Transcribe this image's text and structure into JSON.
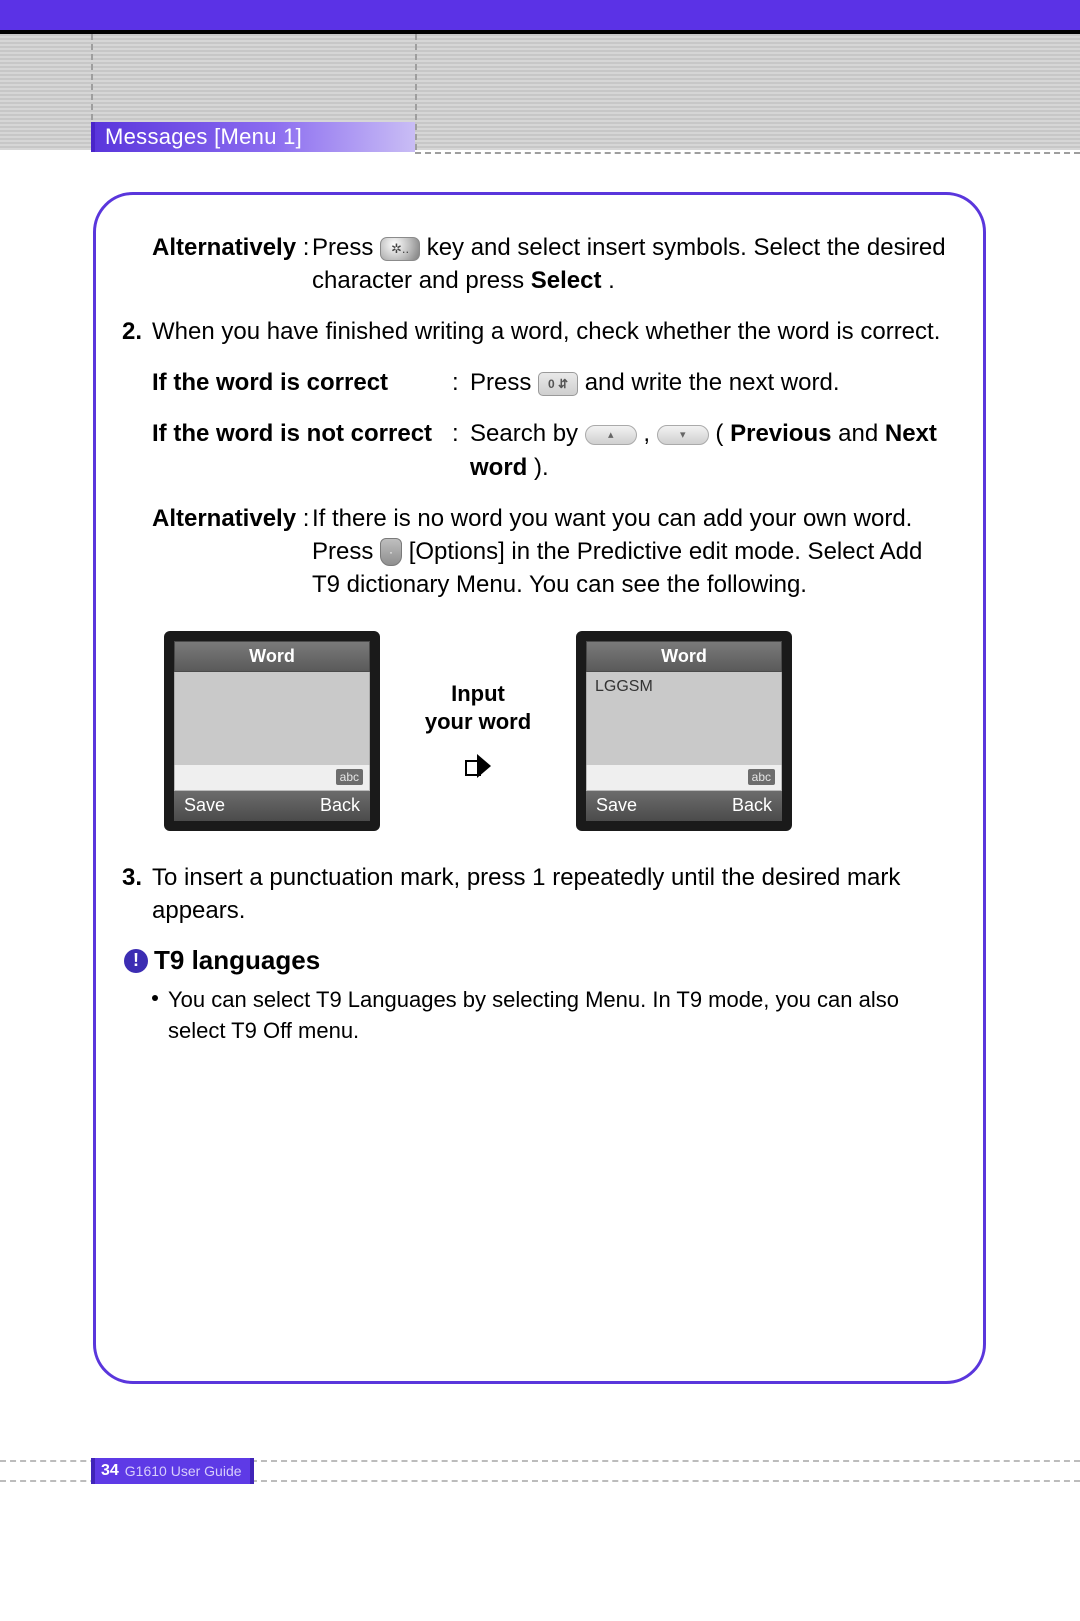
{
  "header": {
    "section_label": "Messages [Menu 1]"
  },
  "para1": {
    "lead": "Alternatively",
    "colon": " : ",
    "t1": "Press ",
    "t2": " key and select insert symbols. Select the desired character and press ",
    "select_bold": "Select",
    "t3": "."
  },
  "step2": {
    "num": "2.",
    "text": "When you have finished writing a word, check whether the word is correct."
  },
  "correct": {
    "label": "If the word is correct",
    "sep": ":",
    "t1": "Press ",
    "t2": " and write the next word."
  },
  "incorrect": {
    "label": "If the word is not correct",
    "sep": ":",
    "t1": "Search by ",
    "comma": " , ",
    "open": " (",
    "prev": "Previous",
    "mid": " and ",
    "next": "Next word",
    "close": ")."
  },
  "alt2": {
    "lead": "Alternatively",
    "sep": " : ",
    "l1": "If there is no word you want you can add your own word.",
    "l2a": "Press ",
    "l2b": " [Options] in the Predictive edit mode. Select Add T9 dictionary Menu. You can see the following."
  },
  "mock": {
    "title": "Word",
    "abc": "abc",
    "save": "Save",
    "back": "Back",
    "mid1": "Input",
    "mid2": "your word",
    "typed": "LGGSM"
  },
  "step3": {
    "num": "3.",
    "text": "To insert a punctuation mark, press 1 repeatedly until the desired mark appears."
  },
  "t9": {
    "head": "T9 languages",
    "bullet": "You can select T9 Languages by selecting Menu. In T9 mode, you can also select T9 Off menu."
  },
  "footer": {
    "page": "34",
    "guide": "G1610 User Guide"
  },
  "icons": {
    "star_key": "✲..",
    "zero_key": "0 ⇵",
    "up_key": "▴",
    "down_key": "▾",
    "soft_key": "·"
  }
}
